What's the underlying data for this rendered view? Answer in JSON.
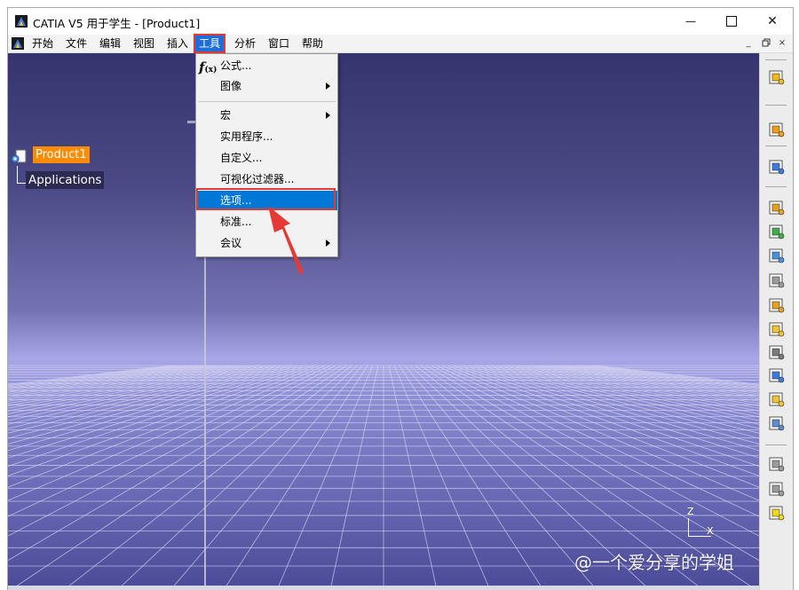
{
  "window": {
    "title": "CATIA V5 用于学生 - [Product1]",
    "controls": {
      "minimize": "—",
      "close": "✕"
    }
  },
  "menubar": {
    "items": [
      "开始",
      "文件",
      "编辑",
      "视图",
      "插入",
      "工具",
      "分析",
      "窗口",
      "帮助"
    ],
    "active": "工具",
    "mdi_controls": {
      "minimize": "_",
      "restore": "🗗",
      "close": "×"
    }
  },
  "tools_menu": {
    "items": [
      {
        "label": "公式...",
        "icon": "fx-icon",
        "submenu": false
      },
      {
        "label": "图像",
        "submenu": true
      },
      {
        "label": "宏",
        "submenu": true
      },
      {
        "label": "实用程序...",
        "submenu": false
      },
      {
        "label": "自定义...",
        "submenu": false
      },
      {
        "label": "可视化过滤器...",
        "submenu": false
      },
      {
        "label": "选项...",
        "submenu": false,
        "highlighted": true
      },
      {
        "label": "标准...",
        "submenu": false
      },
      {
        "label": "会议",
        "submenu": true
      }
    ]
  },
  "tree": {
    "root": "Product1",
    "child": "Applications"
  },
  "compass": {
    "z": "Z",
    "x": "X"
  },
  "watermark": "@一个爱分享的学姐",
  "colors": {
    "menu_active": "#1d6ed8",
    "highlight": "#0078d7",
    "annotation": "#e53935",
    "tree_selected": "#ff8c00"
  },
  "toolbar_icons": [
    "catalog-icon",
    "select-arrow-icon",
    "fly-mode-icon",
    "gear-product-icon",
    "existing-component-icon",
    "component-positioning-icon",
    "replace-component-icon",
    "graph-tree-icon",
    "reorder-icon",
    "numbering-icon",
    "bill-of-material-icon",
    "multi-instantiation-icon",
    "scene-icon",
    "hide-show-icon",
    "view-icon",
    "light-bulb-icon"
  ]
}
